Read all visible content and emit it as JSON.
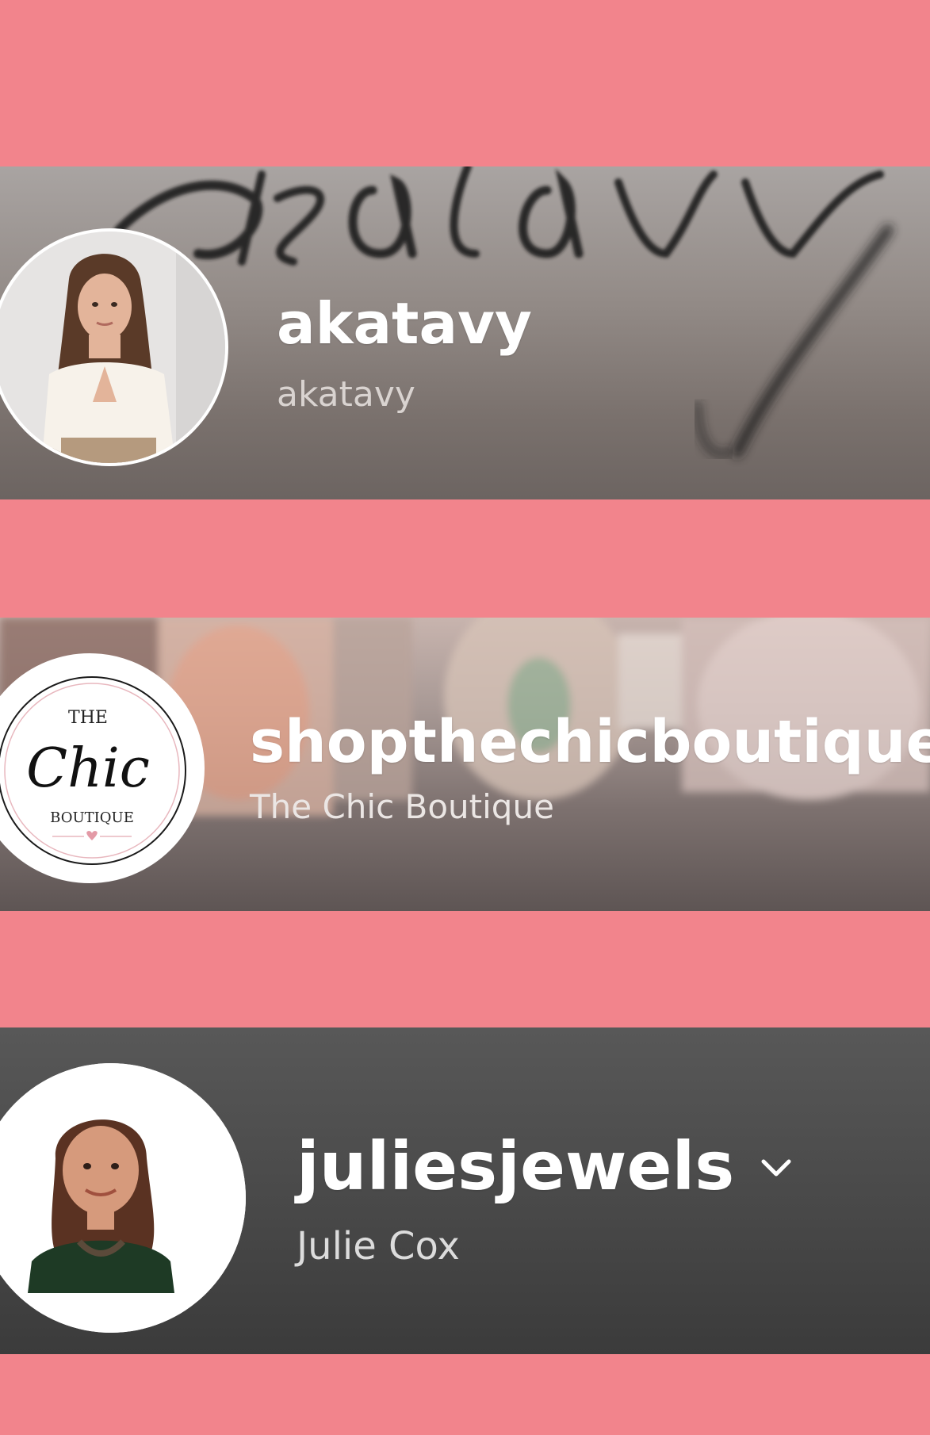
{
  "accounts": [
    {
      "username": "akatavy",
      "display_name": "akatavy",
      "banner_script": "akatavy",
      "avatar_icon": "woman-portrait-photo"
    },
    {
      "username": "shopthechicboutique",
      "display_name": "The Chic Boutique",
      "avatar_icon": "chic-boutique-logo",
      "logo": {
        "top": "THE",
        "middle": "Chic",
        "bottom": "BOUTIQUE"
      }
    },
    {
      "username": "juliesjewels",
      "display_name": "Julie Cox",
      "avatar_icon": "woman-portrait-photo",
      "has_dropdown": true
    }
  ],
  "colors": {
    "background": "#f2848c",
    "username_text": "#ffffff",
    "card3_bg": "#4a4a4a"
  }
}
